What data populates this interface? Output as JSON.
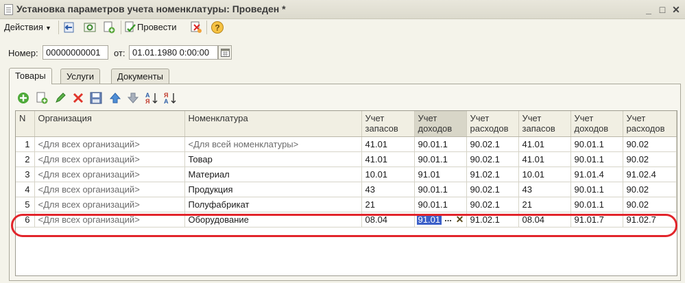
{
  "window": {
    "title": "Установка параметров учета номенклатуры: Проведен *",
    "controls": {
      "minimize": "_",
      "maximize": "□",
      "close": "✕"
    }
  },
  "toolbar": {
    "actions_label": "Действия",
    "post_label": "Провести",
    "icons": [
      "exit-icon",
      "refresh-icon",
      "copy-document-icon",
      "post-document-icon",
      "unpost-document-icon",
      "help-icon"
    ]
  },
  "header": {
    "number_label": "Номер:",
    "number_value": "00000000001",
    "date_label": "от:",
    "date_value": "01.01.1980  0:00:00"
  },
  "tabs": [
    {
      "label": "Товары",
      "active": true
    },
    {
      "label": "Услуги",
      "active": false
    },
    {
      "label": "Документы",
      "active": false
    }
  ],
  "grid_toolbar": {
    "icons": [
      "add-row-icon",
      "copy-row-icon",
      "edit-row-icon",
      "delete-row-icon",
      "save-icon",
      "move-up-icon",
      "move-down-icon",
      "sort-ascending-icon",
      "sort-descending-icon"
    ]
  },
  "table": {
    "columns": [
      "N",
      "Организация",
      "Номенклатура",
      "Учет запасов",
      "Учет доходов",
      "Учет расходов",
      "Учет запасов",
      "Учет доходов",
      "Учет расходов"
    ],
    "rows": [
      [
        "1",
        "<Для всех организаций>",
        "<Для всей номенклатуры>",
        "41.01",
        "90.01.1",
        "90.02.1",
        "41.01",
        "90.01.1",
        "90.02"
      ],
      [
        "2",
        "<Для всех организаций>",
        "Товар",
        "41.01",
        "90.01.1",
        "90.02.1",
        "41.01",
        "90.01.1",
        "90.02"
      ],
      [
        "3",
        "<Для всех организаций>",
        "Материал",
        "10.01",
        "91.01",
        "91.02.1",
        "10.01",
        "91.01.4",
        "91.02.4"
      ],
      [
        "4",
        "<Для всех организаций>",
        "Продукция",
        "43",
        "90.01.1",
        "90.02.1",
        "43",
        "90.01.1",
        "90.02"
      ],
      [
        "5",
        "<Для всех организаций>",
        "Полуфабрикат",
        "21",
        "90.01.1",
        "90.02.1",
        "21",
        "90.01.1",
        "90.02"
      ],
      [
        "6",
        "<Для всех организаций>",
        "Оборудование",
        "08.04",
        "91.01",
        "91.02.1",
        "08.04",
        "91.01.7",
        "91.02.7"
      ]
    ],
    "editing": {
      "row": 6,
      "column": "Учет доходов",
      "value": "91.01",
      "select_button": "...",
      "clear_button": "✕"
    },
    "highlight_color": "#e2252b"
  }
}
